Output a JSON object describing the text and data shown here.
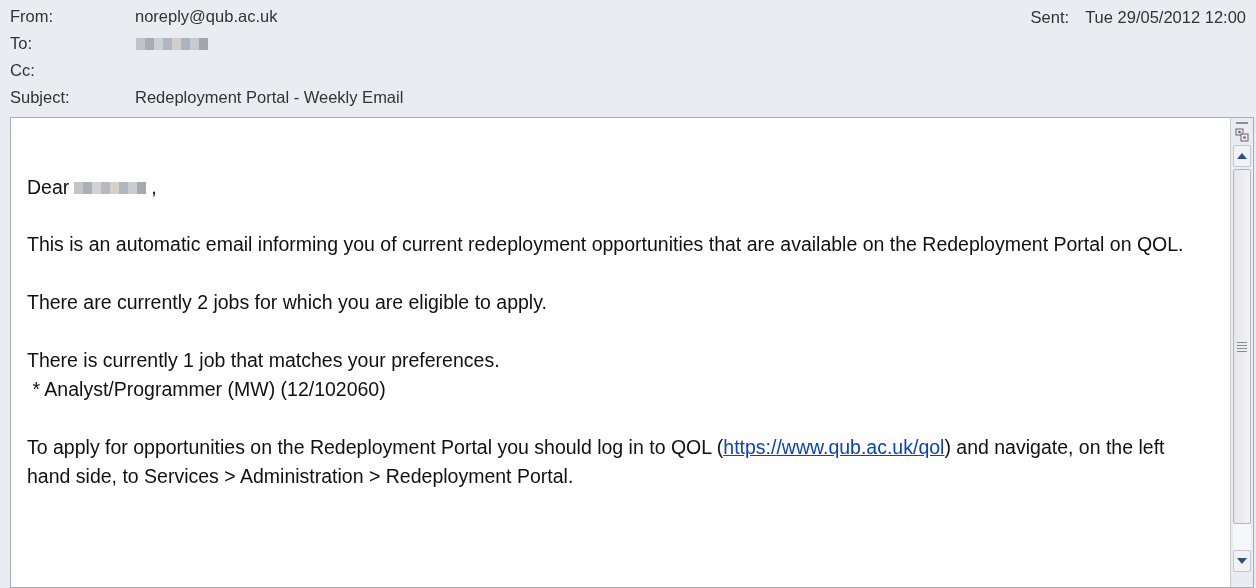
{
  "header": {
    "fields": [
      {
        "label": "From:",
        "value": "noreply@qub.ac.uk"
      },
      {
        "label": "To:",
        "redacted": true
      },
      {
        "label": "Cc:"
      },
      {
        "label": "Subject:",
        "value": "Redeployment Portal - Weekly Email"
      }
    ],
    "sent": {
      "label": "Sent:",
      "value": "Tue 29/05/2012 12:00"
    }
  },
  "body": {
    "greeting": {
      "text": "Dear",
      "redacted": true,
      "punctuation": ","
    },
    "paragraphs": [
      {
        "parts": [
          {
            "kind": "text",
            "text": "This is an automatic email informing you of current redeployment opportunities that are available on the Redeployment Portal on QOL."
          }
        ]
      },
      {
        "parts": [
          {
            "kind": "text",
            "text": "There are currently 2 jobs for which you are eligible to apply."
          }
        ]
      },
      {
        "parts": [
          {
            "kind": "text",
            "text": "There is currently 1 job that matches your preferences."
          }
        ],
        "items": [
          " * Analyst/Programmer (MW) (12/102060)"
        ]
      },
      {
        "parts": [
          {
            "kind": "text",
            "text": "To apply for opportunities on the Redeployment Portal you should log in to QOL ("
          },
          {
            "kind": "link",
            "text": "https://www.qub.ac.uk/qol"
          },
          {
            "kind": "text",
            "text": ") and navigate, on the left hand side, to Services > Administration > Redeployment Portal."
          }
        ]
      }
    ]
  }
}
